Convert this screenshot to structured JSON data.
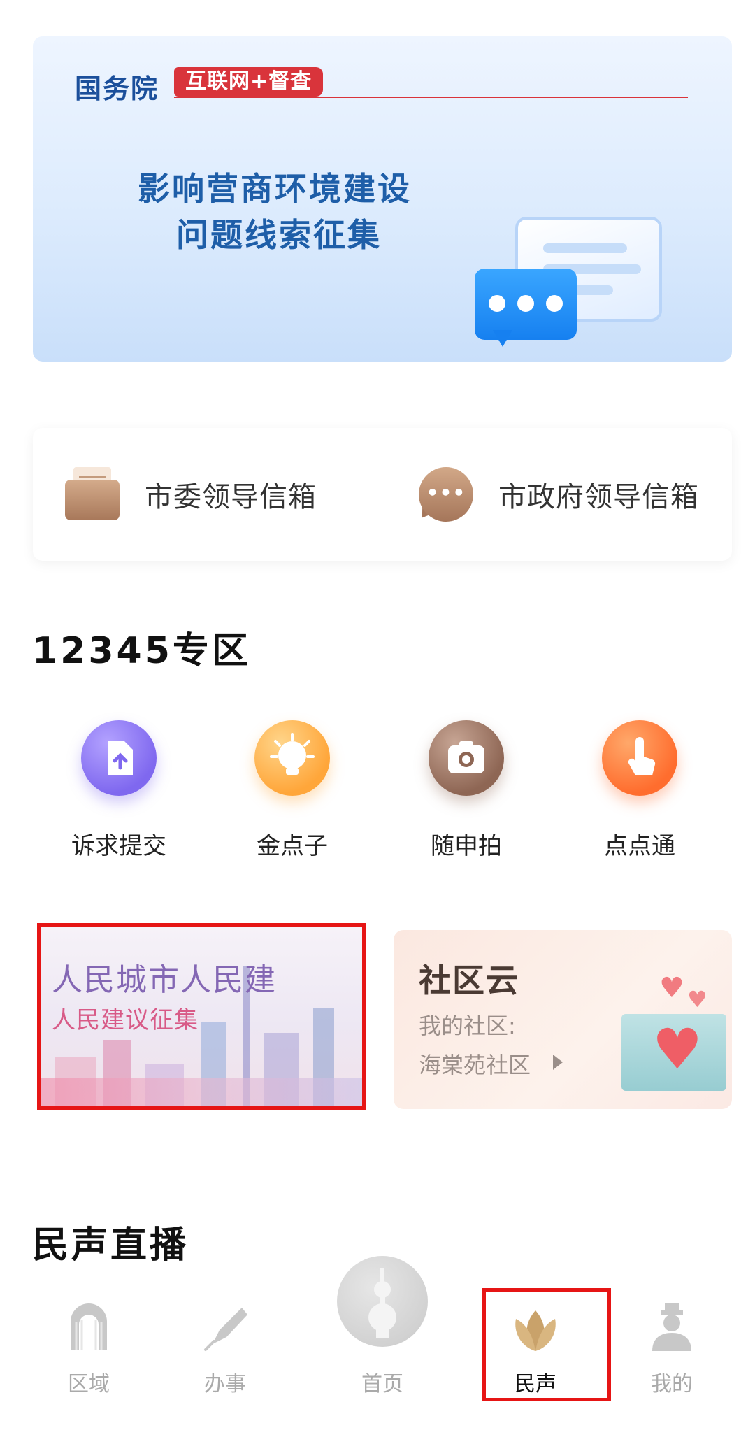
{
  "banner": {
    "org": "国务院",
    "tag": "互联网+督查",
    "title_line1": "影响营商环境建设",
    "title_line2": "问题线索征集"
  },
  "mailboxes": [
    {
      "label": "市委领导信箱",
      "icon": "envelope-icon"
    },
    {
      "label": "市政府领导信箱",
      "icon": "chat-bubble-icon"
    }
  ],
  "zone_12345": {
    "title": "12345专区",
    "services": [
      {
        "label": "诉求提交",
        "icon": "upload-file-icon"
      },
      {
        "label": "金点子",
        "icon": "lightbulb-icon"
      },
      {
        "label": "随申拍",
        "icon": "camera-icon"
      },
      {
        "label": "点点通",
        "icon": "tap-hand-icon"
      }
    ]
  },
  "city_card": {
    "title": "人民城市人民建",
    "subtitle": "人民建议征集"
  },
  "community_card": {
    "title": "社区云",
    "label": "我的社区:",
    "value": "海棠苑社区"
  },
  "live_section": {
    "title": "民声直播"
  },
  "bottom_nav": [
    {
      "label": "区域",
      "icon": "arch-gate-icon",
      "active": false
    },
    {
      "label": "办事",
      "icon": "pen-nib-icon",
      "active": false
    },
    {
      "label": "首页",
      "icon": "tower-icon",
      "active": false
    },
    {
      "label": "民声",
      "icon": "magnolia-icon",
      "active": true
    },
    {
      "label": "我的",
      "icon": "person-icon",
      "active": false
    }
  ],
  "colors": {
    "accent_red": "#e61515",
    "banner_blue": "#1e5ea8",
    "brown": "#a8785a",
    "gold": "#c9a26a"
  }
}
